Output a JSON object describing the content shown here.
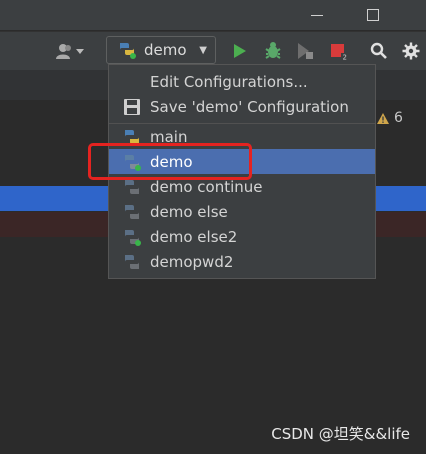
{
  "toolbar": {
    "run_config_label": "demo"
  },
  "dropdown": {
    "actions": [
      {
        "label": "Edit Configurations..."
      },
      {
        "label": "Save 'demo' Configuration"
      }
    ],
    "configs": [
      {
        "label": "main"
      },
      {
        "label": "demo",
        "selected": true
      },
      {
        "label": "demo continue"
      },
      {
        "label": "demo else"
      },
      {
        "label": "demo else2"
      },
      {
        "label": "demopwd2"
      }
    ]
  },
  "editor": {
    "warning_count": "6"
  },
  "watermark": "CSDN @坦笑&&life",
  "colors": {
    "run_green": "#4caf50",
    "highlight_red": "#e52320",
    "selection_blue": "#4b6eaf"
  },
  "icons": [
    "minimize-icon",
    "maximize-icon",
    "user-icon",
    "python-icon",
    "run-icon",
    "debug-icon",
    "coverage-icon",
    "stop-icon",
    "search-icon",
    "gear-icon",
    "save-icon",
    "warning-icon"
  ]
}
